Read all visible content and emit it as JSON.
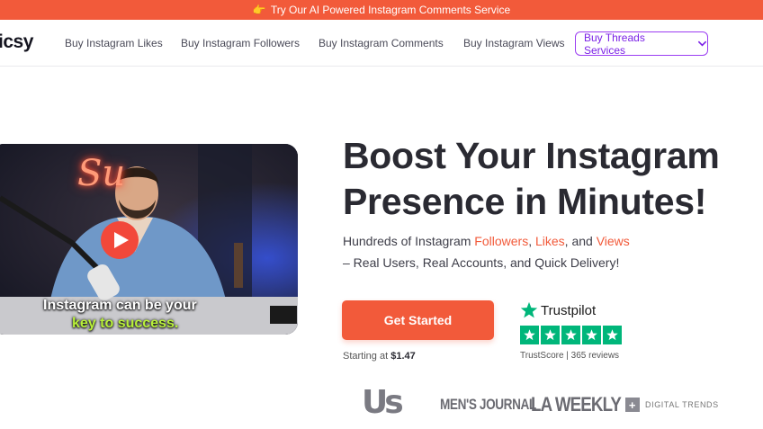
{
  "promo_bar": {
    "icon": "pointing-hand-icon",
    "hand_glyph": "👉",
    "text": "Try Our AI Powered Instagram Comments Service"
  },
  "nav": {
    "logo": "icsy",
    "links": [
      "Buy Instagram Likes",
      "Buy Instagram Followers",
      "Buy Instagram Comments",
      "Buy Instagram Views"
    ],
    "threads_button": "Buy Threads Services"
  },
  "video": {
    "neon_sign": "Su",
    "caption_line1": "Instagram can be your",
    "caption_line2": "key to success."
  },
  "hero": {
    "headline_line1": "Boost Your Instagram",
    "headline_line2": "Presence in Minutes!",
    "sub_prefix": "Hundreds of Instagram ",
    "sub_followers": "Followers",
    "sub_comma": ", ",
    "sub_likes": "Likes",
    "sub_and": ", and ",
    "sub_views": "Views",
    "sub_line2": "– Real Users, Real Accounts, and Quick Delivery!",
    "cta_label": "Get Started",
    "price_prefix": "Starting at ",
    "price_value": "$1.47"
  },
  "trustpilot": {
    "brand": "Trustpilot",
    "stars": 5,
    "score_text": "TrustScore | 365 reviews"
  },
  "press": {
    "us": "Us",
    "mens_journal": "MEN'S JOURNAL",
    "la_weekly": "LA WEEKLY",
    "digital_trends": "DIGITAL TRENDS"
  },
  "colors": {
    "accent": "#f25a3a",
    "threads": "#9b3df2",
    "trustpilot_green": "#00b67a"
  }
}
